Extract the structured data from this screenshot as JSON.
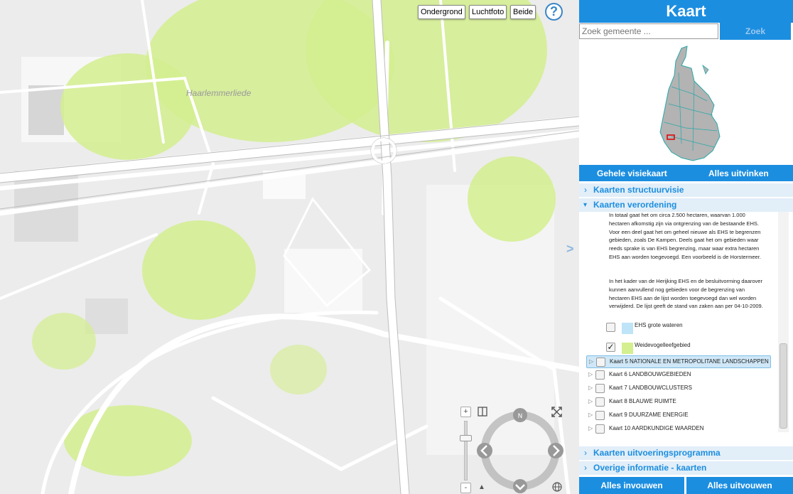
{
  "map": {
    "maptypes": [
      "Ondergrond",
      "Luchtfoto",
      "Beide"
    ],
    "help_label": "?",
    "place_label": "Haarlemmerliede",
    "expander": ">",
    "zoom_in": "+",
    "zoom_out": "-"
  },
  "panel": {
    "title": "Kaart",
    "search_placeholder": "Zoek gemeente ...",
    "search_button": "Zoek",
    "bar_left": "Gehele visiekaart",
    "bar_right": "Alles uitvinken",
    "sections": {
      "structuurvisie": "Kaarten structuurvisie",
      "verordening": "Kaarten verordening",
      "uitvoering": "Kaarten uitvoeringsprogramma",
      "overige": "Overige informatie - kaarten"
    },
    "paragraph1": "In totaal gaat het om circa 2.500 hectaren, waarvan 1.000 hectaren afkomstig zijn via ontgrenzing van de bestaande EHS. Voor een deel gaat het om geheel nieuwe als EHS te begrenzen gebieden, zoals De Kampen. Deels gaat het om gebieden waar reeds sprake is van EHS begrenzing, maar waar extra hectaren EHS aan worden toegevoegd. Een voorbeeld is de Horstermeer.",
    "paragraph2": "In het kader van de Herijking EHS en de besluitvorming daarover kunnen aanvullend nog gebieden voor de begrenzing van hectaren EHS aan de lijst worden toegevoegd dan wel worden verwijderd. De lijst geeft de stand van zaken aan per 04-10-2009.",
    "layers": [
      {
        "label": "EHS grote wateren",
        "checked": false,
        "color": "#bfe3f7"
      },
      {
        "label": "Weidevogelleefgebied",
        "checked": true,
        "color": "#d3ef8f"
      }
    ],
    "kaarten": [
      {
        "label": "Kaart 5 NATIONALE EN METROPOLITANE LANDSCHAPPEN"
      },
      {
        "label": "Kaart 6 LANDBOUWGEBIEDEN"
      },
      {
        "label": "Kaart 7 LANDBOUWCLUSTERS"
      },
      {
        "label": "Kaart 8 BLAUWE RUIMTE"
      },
      {
        "label": "Kaart 9 DUURZAME ENERGIE"
      },
      {
        "label": "Kaart 10 AARDKUNDIGE WAARDEN"
      }
    ],
    "footer_left": "Alles invouwen",
    "footer_right": "Alles uitvouwen"
  },
  "colors": {
    "accent": "#1c8ee0",
    "green_area": "#d3ef8f"
  }
}
